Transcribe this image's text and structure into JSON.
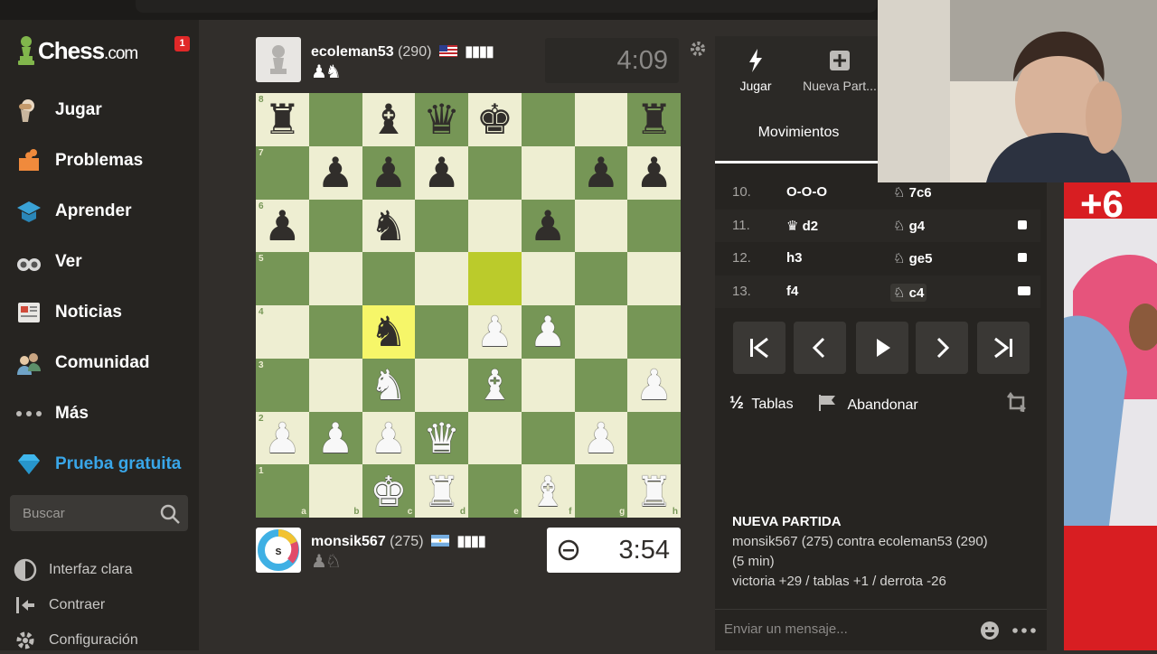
{
  "sidebar": {
    "logo_main": "Chess",
    "logo_suffix": ".com",
    "notification_count": "1",
    "items": [
      {
        "label": "Jugar",
        "icon": "play-hand-icon"
      },
      {
        "label": "Problemas",
        "icon": "puzzle-icon"
      },
      {
        "label": "Aprender",
        "icon": "learn-cap-icon"
      },
      {
        "label": "Ver",
        "icon": "binoculars-icon"
      },
      {
        "label": "Noticias",
        "icon": "news-icon"
      },
      {
        "label": "Comunidad",
        "icon": "community-icon"
      },
      {
        "label": "Más",
        "icon": "more-dots-icon"
      },
      {
        "label": "Prueba gratuita",
        "icon": "diamond-icon"
      }
    ],
    "search_placeholder": "Buscar",
    "footer": [
      {
        "label": "Interfaz clara",
        "icon": "contrast-icon"
      },
      {
        "label": "Contraer",
        "icon": "collapse-icon"
      },
      {
        "label": "Configuración",
        "icon": "settings-icon"
      }
    ]
  },
  "top_player": {
    "name": "ecoleman53",
    "rating": "(290)",
    "captured": "♟♞",
    "clock": "4:09"
  },
  "bottom_player": {
    "name": "monsik567",
    "rating": "(275)",
    "avatar_letter": "s",
    "captured": "♟♘",
    "clock": "3:54"
  },
  "board": {
    "ranks": [
      "8",
      "7",
      "6",
      "5",
      "4",
      "3",
      "2",
      "1"
    ],
    "files": [
      "a",
      "b",
      "c",
      "d",
      "e",
      "f",
      "g",
      "h"
    ],
    "position": [
      [
        "r",
        "",
        "b",
        "q",
        "k",
        "",
        "",
        "r"
      ],
      [
        "",
        "p",
        "p",
        "p",
        "",
        "",
        "p",
        "p"
      ],
      [
        "p",
        "",
        "n",
        "",
        "",
        "p",
        "",
        ""
      ],
      [
        "",
        "",
        "",
        "",
        "",
        "",
        "",
        ""
      ],
      [
        "",
        "",
        "n",
        "",
        "P",
        "P",
        "",
        ""
      ],
      [
        "",
        "",
        "N",
        "",
        "B",
        "",
        "",
        "P"
      ],
      [
        "P",
        "P",
        "P",
        "Q",
        "",
        "",
        "P",
        ""
      ],
      [
        "",
        "",
        "K",
        "R",
        "",
        "B",
        "",
        "R"
      ]
    ],
    "highlight_last_move": [
      "e5",
      "c4"
    ]
  },
  "right_panel": {
    "tabs": [
      {
        "label": "Jugar",
        "icon": "bolt-icon"
      },
      {
        "label": "Nueva Part...",
        "icon": "plus-box-icon"
      }
    ],
    "moves_tab": "Movimientos",
    "moves": [
      {
        "n": "10.",
        "white": "O-O-O",
        "black": "7c6",
        "black_icon": "♘"
      },
      {
        "n": "11.",
        "white": "d2",
        "white_icon": "♛",
        "black": "g4",
        "black_icon": "♘"
      },
      {
        "n": "12.",
        "white": "h3",
        "black": "ge5",
        "black_icon": "♘"
      },
      {
        "n": "13.",
        "white": "f4",
        "black": "c4",
        "black_icon": "♘"
      }
    ],
    "draw_label": "Tablas",
    "draw_icon_text": "½",
    "resign_label": "Abandonar",
    "info_title": "NUEVA PARTIDA",
    "info_line1": "monsik567 (275) contra ecoleman53 (290)",
    "info_line2": "(5 min)",
    "info_line3": "victoria +29 / tablas +1 / derrota -26",
    "message_placeholder": "Enviar un mensaje..."
  },
  "ad": {
    "text": "+6"
  },
  "colors": {
    "board_light": "#eeeed2",
    "board_dark": "#769656",
    "last_move": "#bbcb2b",
    "accent_blue": "#39a6e8"
  }
}
